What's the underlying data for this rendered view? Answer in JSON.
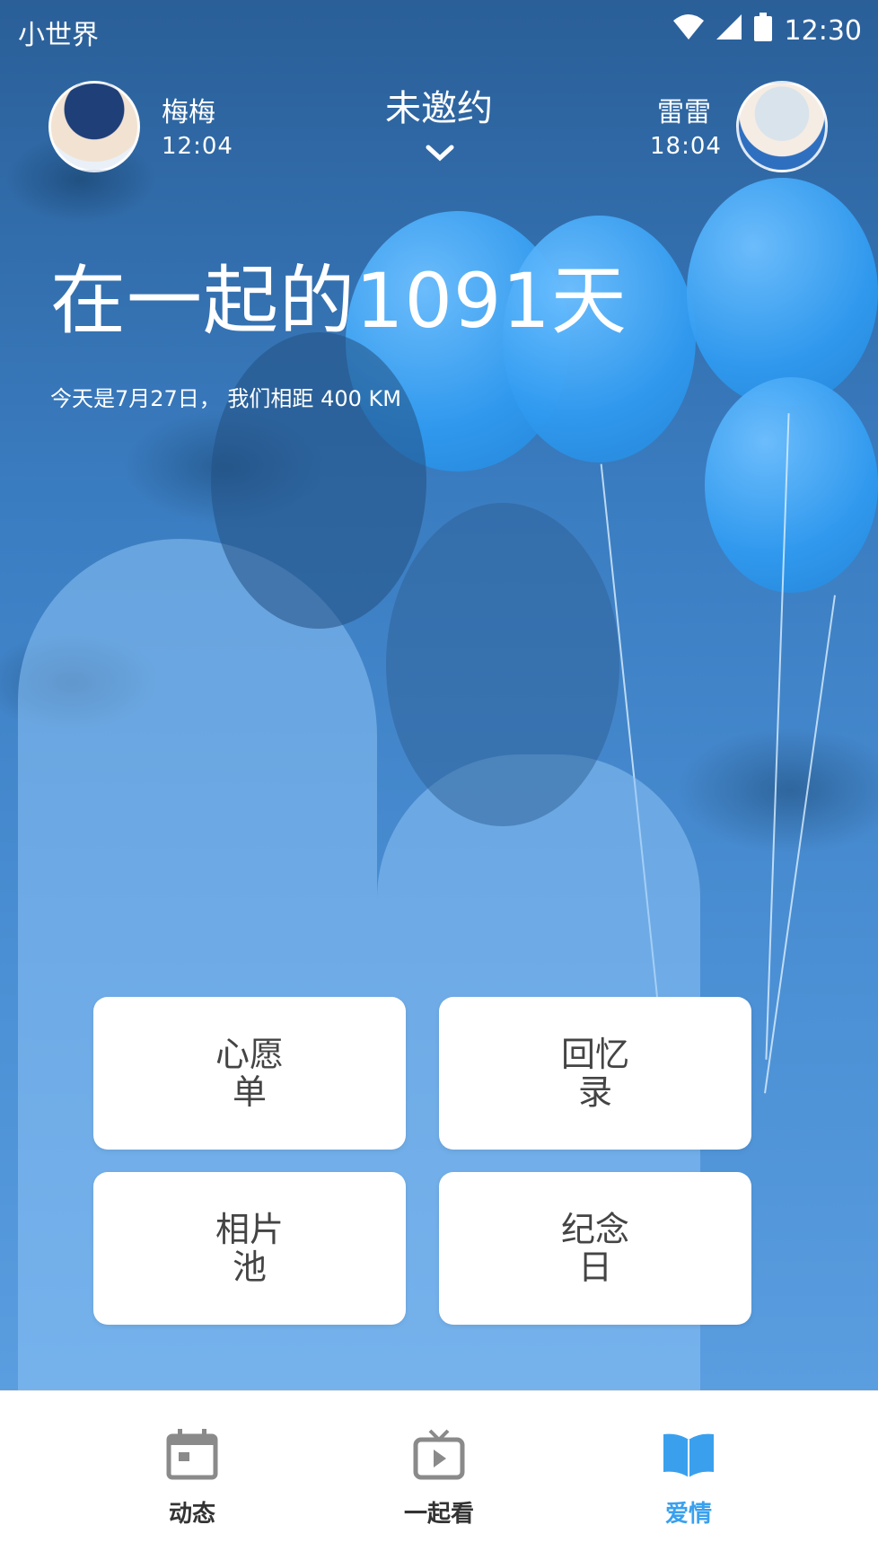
{
  "status_bar": {
    "carrier": "小世界",
    "time": "12:30"
  },
  "header": {
    "left_user": {
      "name": "梅梅",
      "time": "12:04"
    },
    "date_status": "未邀约",
    "right_user": {
      "name": "雷雷",
      "time": "18:04"
    }
  },
  "hero": {
    "title": "在一起的1091天",
    "subtitle": "今天是7月27日， 我们相距 400 KM"
  },
  "cards": [
    {
      "label": "心愿单"
    },
    {
      "label": "回忆录"
    },
    {
      "label": "相片池"
    },
    {
      "label": "纪念日"
    }
  ],
  "bottom_nav": {
    "items": [
      {
        "label": "动态",
        "icon": "calendar-icon"
      },
      {
        "label": "一起看",
        "icon": "tv-icon"
      },
      {
        "label": "爱情",
        "icon": "book-icon"
      }
    ],
    "active_color": "#3aa0ee",
    "inactive_color": "#8a8a8a"
  }
}
